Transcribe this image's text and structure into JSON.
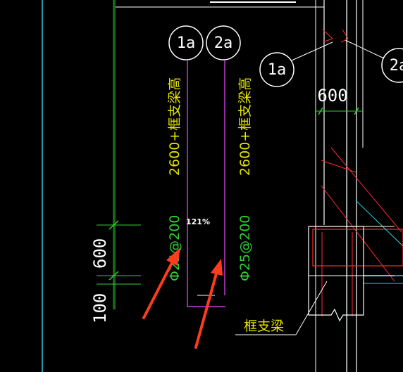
{
  "canvas": {
    "background": "#000000",
    "zoom_readout": "121%"
  },
  "colors": {
    "green": "#2fd12f",
    "yellow": "#e5e500",
    "magenta": "#c23bd6",
    "white": "#ffffff",
    "red": "#ff2a2a",
    "cyan": "#28d0e0",
    "annotation_arrow": "#ff3b1f"
  },
  "bubbles": {
    "bubble_1a": "1a",
    "bubble_2a": "2a",
    "bubble_1a_right": "1a",
    "bubble_2a_cut": "2a"
  },
  "bar_labels": {
    "left_length": "2600+框支梁高",
    "left_spacing": "Φ25@200",
    "right_length": "2600+框支梁高",
    "right_spacing": "Φ25@200"
  },
  "dimensions": {
    "top_width": "600",
    "left_height_600": "600",
    "left_height_100": "100"
  },
  "callout": {
    "label": "框支梁"
  }
}
